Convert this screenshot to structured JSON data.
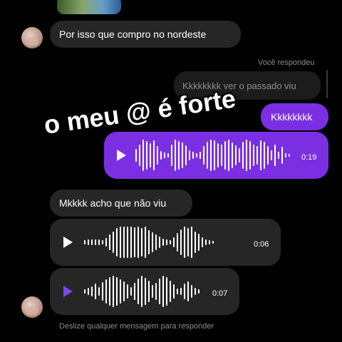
{
  "messages": {
    "incoming_1": "Por isso que compro no nordeste",
    "reply_label": "Você respondeu",
    "replied_text": "Kkkkkkkk ver o passado viu",
    "outgoing_1": "Kkkkkkkk",
    "outgoing_voice_duration": "0:19",
    "incoming_2": "Mkkkk acho que não viu",
    "incoming_voice_1_duration": "0:06",
    "incoming_voice_2_duration": "0:07"
  },
  "overlay_caption": "o meu @ é forte",
  "footer_hint": "Deslize qualquer mensagem para responder",
  "colors": {
    "background": "#000000",
    "incoming_bubble": "#262626",
    "outgoing_bubble": "#7b2fe3",
    "accent_play": "#7a4ae8"
  },
  "icons": {
    "play": "play-icon",
    "avatar": "avatar"
  }
}
